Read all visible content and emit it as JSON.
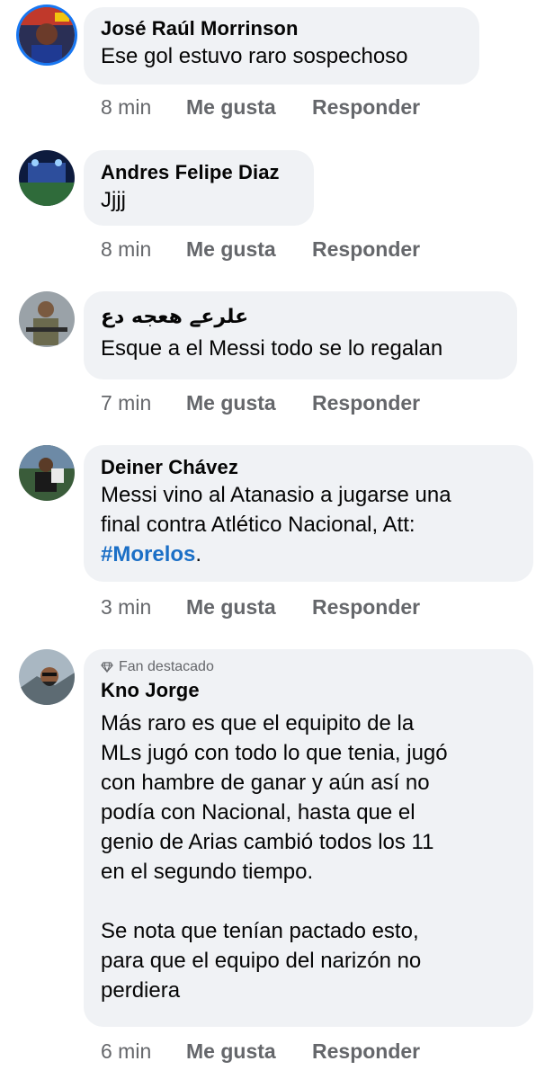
{
  "comments": [
    {
      "name": "José Raúl Morrinson",
      "text": "Ese gol estuvo raro sospechoso",
      "time": "8 min",
      "like": "Me gusta",
      "reply": "Responder"
    },
    {
      "name": "Andres Felipe Diaz",
      "text": "Jjjj",
      "time": "8 min",
      "like": "Me gusta",
      "reply": "Responder"
    },
    {
      "name": "علرعے ھعجه دع",
      "text": "Esque a el Messi todo se lo regalan",
      "time": "7 min",
      "like": "Me gusta",
      "reply": "Responder"
    },
    {
      "name": "Deiner Chávez",
      "text": "Messi vino al Atanasio a jugarse una\nfinal contra Atlético Nacional, Att:",
      "hashtag": "#Morelos",
      "after_hashtag": ".",
      "time": "3 min",
      "like": "Me gusta",
      "reply": "Responder"
    },
    {
      "badge": "Fan destacado",
      "badge_icon": "diamond-icon",
      "name": "Kno Jorge",
      "text": "Más raro es que el equipito de la\nMLs jugó con todo lo que tenia, jugó\ncon hambre de ganar y aún así no\npodía con Nacional, hasta que el\ngenio de Arias cambió todos los 11\nen el segundo tiempo.\n\nSe nota que tenían pactado esto,\npara que el equipo del narizón no\nperdiera",
      "time": "6 min",
      "like": "Me gusta",
      "reply": "Responder"
    }
  ]
}
